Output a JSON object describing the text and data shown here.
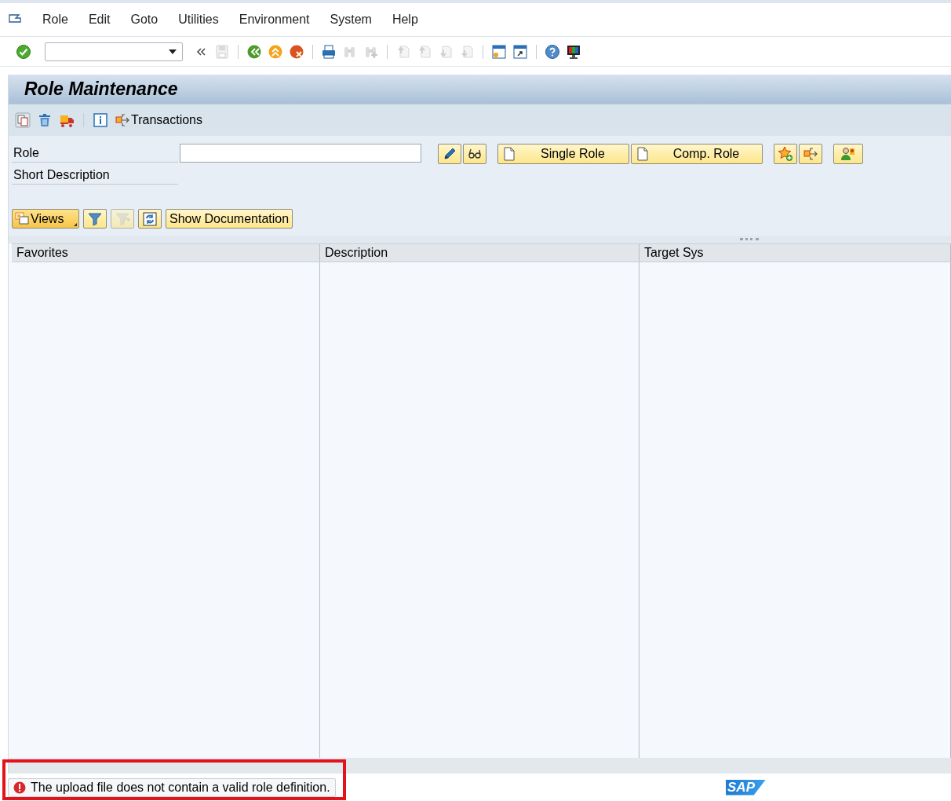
{
  "menu": [
    {
      "label": "Role"
    },
    {
      "label": "Edit"
    },
    {
      "label": "Goto"
    },
    {
      "label": "Utilities"
    },
    {
      "label": "Environment"
    },
    {
      "label": "System"
    },
    {
      "label": "Help"
    }
  ],
  "toolbar": [
    {
      "kind": "enter",
      "disabled": false
    },
    {
      "kind": "command-field"
    },
    {
      "kind": "chevrons",
      "disabled": false
    },
    {
      "kind": "save",
      "disabled": true
    },
    {
      "kind": "separator"
    },
    {
      "kind": "back",
      "disabled": false
    },
    {
      "kind": "exit",
      "disabled": false
    },
    {
      "kind": "cancel",
      "disabled": false
    },
    {
      "kind": "separator"
    },
    {
      "kind": "print",
      "disabled": false
    },
    {
      "kind": "find",
      "disabled": true
    },
    {
      "kind": "find-next",
      "disabled": true
    },
    {
      "kind": "separator"
    },
    {
      "kind": "first-page",
      "disabled": true
    },
    {
      "kind": "prev-page",
      "disabled": true
    },
    {
      "kind": "next-page",
      "disabled": true
    },
    {
      "kind": "last-page",
      "disabled": true
    },
    {
      "kind": "separator"
    },
    {
      "kind": "new-session",
      "disabled": false
    },
    {
      "kind": "shortcut",
      "disabled": false
    },
    {
      "kind": "separator"
    },
    {
      "kind": "help",
      "disabled": false
    },
    {
      "kind": "layout",
      "disabled": false
    }
  ],
  "title": "Role Maintenance",
  "app_toolbar": [
    {
      "kind": "other-object"
    },
    {
      "kind": "delete"
    },
    {
      "kind": "transport"
    },
    {
      "kind": "separator"
    },
    {
      "kind": "info"
    },
    {
      "kind": "transactions",
      "label": "Transactions"
    }
  ],
  "form": {
    "fields": [
      {
        "label": "Role",
        "kind": "input"
      },
      {
        "label": "Short Description",
        "kind": "text"
      }
    ],
    "buttons": [
      {
        "kind": "edit"
      },
      {
        "kind": "display"
      },
      {
        "kind": "gap"
      },
      {
        "kind": "single-role",
        "label": "Single Role"
      },
      {
        "kind": "comp-role",
        "label": "Comp. Role"
      },
      {
        "kind": "gap"
      },
      {
        "kind": "add-favorite"
      },
      {
        "kind": "transfer"
      },
      {
        "kind": "gap"
      },
      {
        "kind": "user"
      }
    ]
  },
  "views_toolbar": [
    {
      "kind": "views",
      "label": "Views"
    },
    {
      "kind": "filter",
      "disabled": false
    },
    {
      "kind": "filter-off",
      "disabled": true
    },
    {
      "kind": "refresh",
      "disabled": false
    },
    {
      "kind": "documentation",
      "label": "Show Documentation"
    }
  ],
  "table": {
    "columns": [
      "Favorites",
      "Description",
      "Target Sys"
    ]
  },
  "status_bar": {
    "kind": "error",
    "message": "The upload file does not contain a valid role definition.",
    "highlighted": true,
    "logo": "SAP"
  }
}
